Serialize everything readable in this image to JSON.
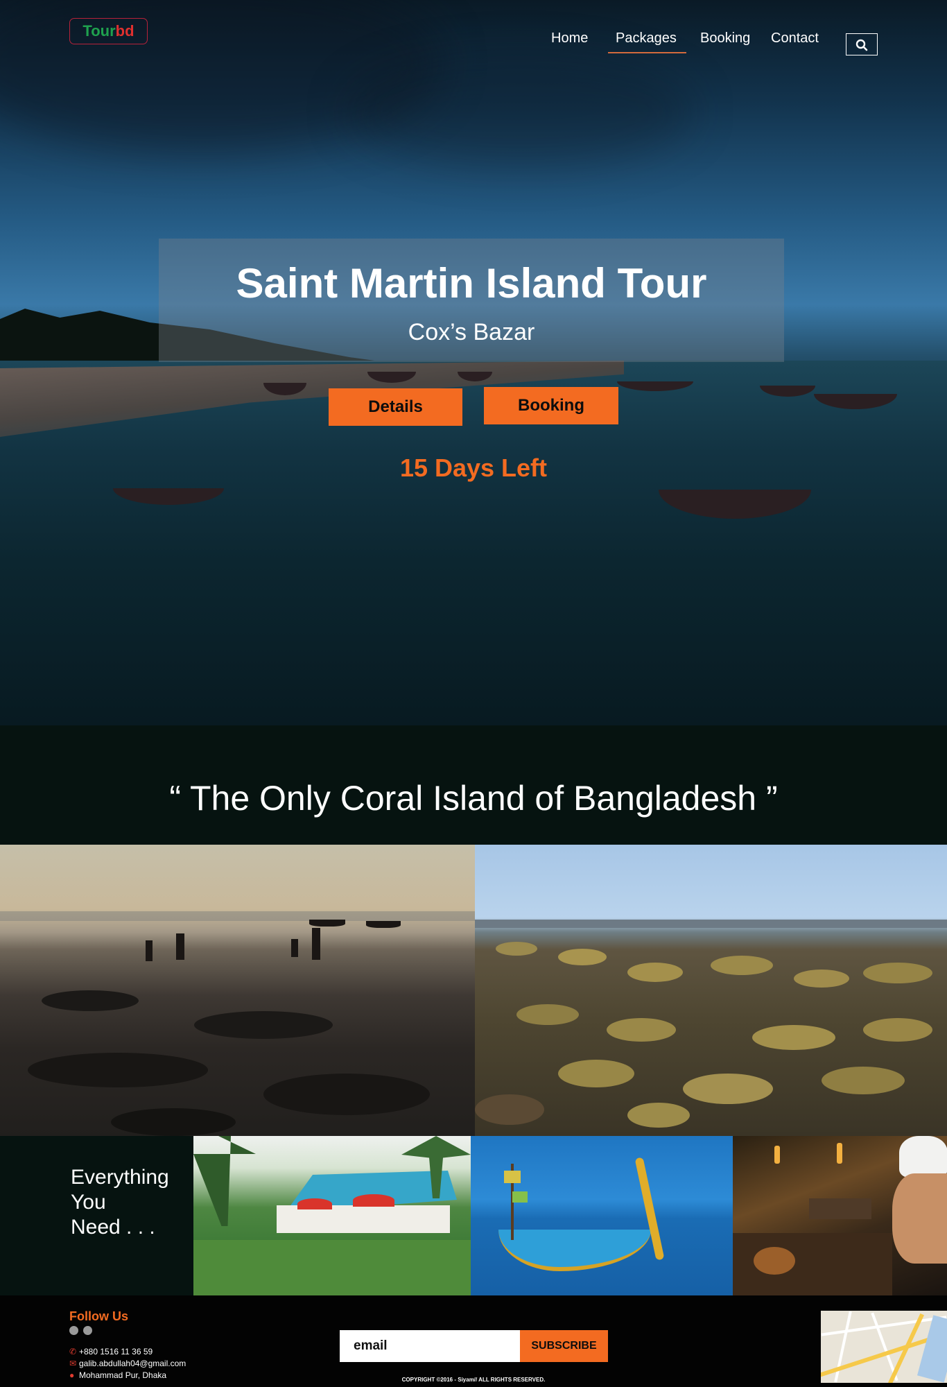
{
  "logo": {
    "part1": "Tour",
    "part2": "bd"
  },
  "nav": {
    "items": [
      {
        "label": "Home"
      },
      {
        "label": "Packages"
      },
      {
        "label": "Booking"
      },
      {
        "label": "Contact"
      }
    ],
    "active": "Packages"
  },
  "hero": {
    "title": "Saint Martin Island Tour",
    "subtitle": "Cox’s Bazar",
    "details_label": "Details",
    "booking_label": "Booking",
    "days_left": "15 Days Left"
  },
  "quote": "“ The Only Coral Island of Bangladesh ”",
  "everything": {
    "line1": "Everything",
    "line2": "You",
    "line3": "Need . . ."
  },
  "footer": {
    "follow_label": "Follow Us",
    "phone": "+880 1516 11 36 59",
    "email": "galib.abdullah04@gmail.com",
    "address": "Mohammad Pur, Dhaka",
    "email_placeholder": "email",
    "subscribe_label": "SUBSCRIBE",
    "copyright": "COPYRIGHT ©2016 - Siyam//  ALL RIGHTS RESERVED."
  },
  "colors": {
    "accent": "#f36b21",
    "logo_green": "#1fa14e",
    "logo_red": "#e0302f",
    "dark_bg": "#061310"
  },
  "icons": [
    "search-icon",
    "facebook-icon",
    "twitter-icon",
    "phone-icon",
    "mail-icon",
    "location-icon",
    "map-image"
  ]
}
